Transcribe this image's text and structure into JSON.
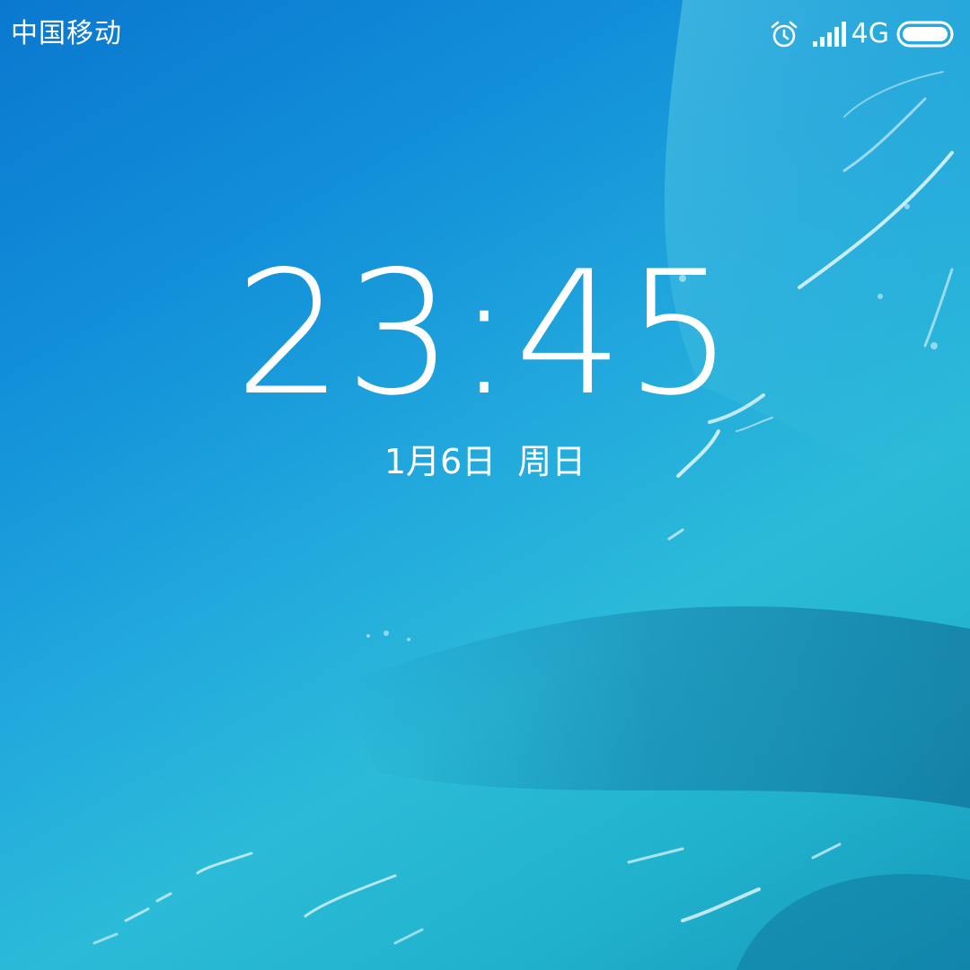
{
  "status_bar": {
    "carrier": "中国移动",
    "network": "4G",
    "icons": [
      "alarm-icon",
      "signal-icon",
      "battery-icon"
    ]
  },
  "lock_screen": {
    "time": "23:45",
    "date": "1月6日",
    "weekday": "周日"
  },
  "wallpaper": {
    "description_icon": "ocean-wallpaper",
    "colors": {
      "deep_sea": "#0a78cf",
      "shallow_sea": "#2bbbd8",
      "surf": "#e6f7fb"
    }
  }
}
